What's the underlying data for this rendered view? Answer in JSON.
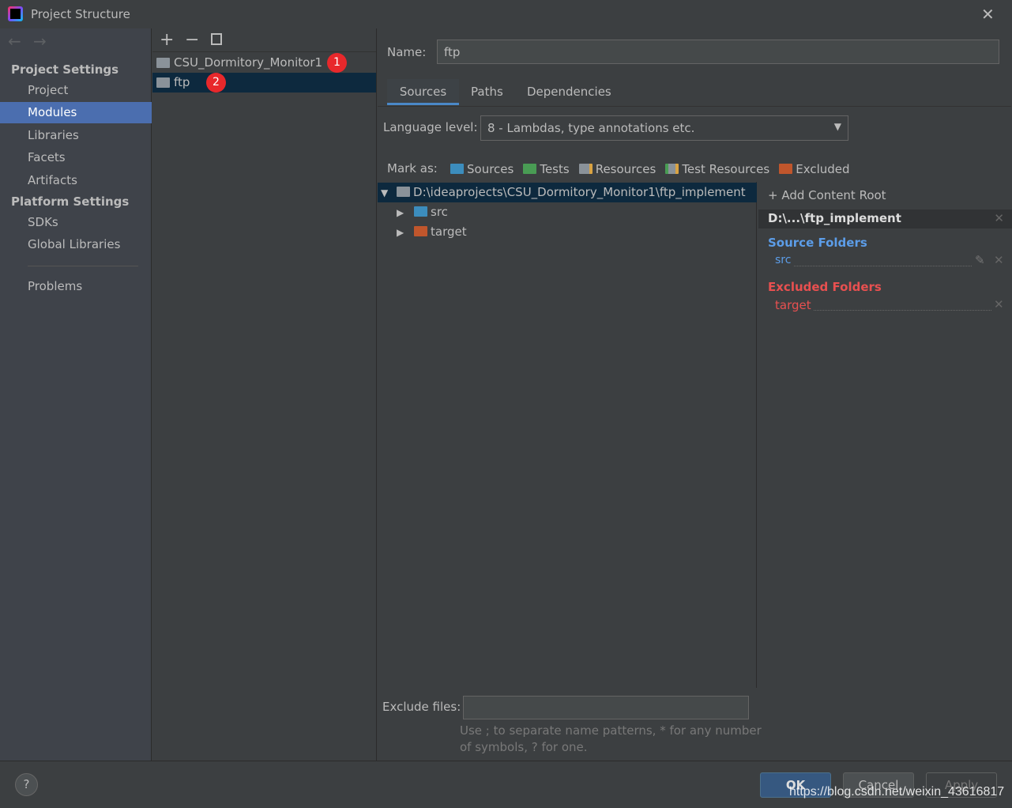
{
  "window": {
    "title": "Project Structure"
  },
  "sidebar": {
    "project_settings": "Project Settings",
    "items": [
      "Project",
      "Modules",
      "Libraries",
      "Facets",
      "Artifacts"
    ],
    "platform_settings": "Platform Settings",
    "platform_items": [
      "SDKs",
      "Global Libraries"
    ],
    "problems": "Problems"
  },
  "modules": {
    "items": [
      {
        "name": "CSU_Dormitory_Monitor1",
        "badge": "1"
      },
      {
        "name": "ftp",
        "badge": "2"
      }
    ]
  },
  "detail": {
    "name_label": "Name:",
    "name_value": "ftp",
    "tabs": [
      "Sources",
      "Paths",
      "Dependencies"
    ],
    "language_label": "Language level:",
    "language_value": "8 - Lambdas, type annotations etc.",
    "mark_as": "Mark as:",
    "mark_buttons": [
      {
        "label": "Sources",
        "color": "#3c8dbd"
      },
      {
        "label": "Tests",
        "color": "#499c54"
      },
      {
        "label": "Resources",
        "color": "#8a9299"
      },
      {
        "label": "Test Resources",
        "color": "#8a9299"
      },
      {
        "label": "Excluded",
        "color": "#c0562c"
      }
    ],
    "tree": {
      "root": "D:\\ideaprojects\\CSU_Dormitory_Monitor1\\ftp_implement",
      "children": [
        {
          "name": "src",
          "color": "#3c8dbd"
        },
        {
          "name": "target",
          "color": "#c0562c"
        }
      ]
    },
    "exclude_label": "Exclude files:",
    "exclude_value": "",
    "hint": "Use ; to separate name patterns, * for any number",
    "hint2": "of symbols, ? for one."
  },
  "content_root": {
    "add": "Add Content Root",
    "root": "D:\\...\\ftp_implement",
    "source_title": "Source Folders",
    "source_item": "src",
    "excluded_title": "Excluded Folders",
    "excluded_item": "target"
  },
  "footer": {
    "ok": "OK",
    "cancel": "Cancel",
    "apply": "Apply",
    "help": "?",
    "watermark": "https://blog.csdn.net/weixin_43616817"
  }
}
